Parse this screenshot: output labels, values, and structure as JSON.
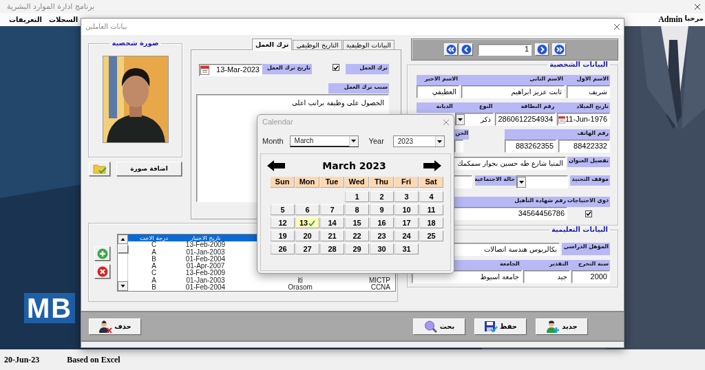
{
  "app": {
    "title": "برنامج ادارة الموارد البشرية",
    "menu": [
      {
        "label": "السجلات"
      },
      {
        "label": "التعريفات"
      }
    ],
    "user": "Admin",
    "greeting": "مرحبا",
    "logo": "MB"
  },
  "dialog": {
    "title": "بيانات العاملين",
    "photo": {
      "legend": "صورة شخصية",
      "kind": "picture",
      "add_button": "اضافة صورة"
    },
    "tabs": [
      {
        "label": "البيانات الوظيفية",
        "selected": false
      },
      {
        "label": "التاريخ الوظيفي",
        "selected": false
      },
      {
        "label": "ترك العمل",
        "selected": true
      }
    ],
    "leave_work": {
      "left_label": "ترك العمل",
      "left_checked": true,
      "date_label": "تاريخ ترك العمل",
      "date": "13-Mar-2023",
      "reason_label": "سبب ترك العمل",
      "reason": "الحصول على وظيفة براتب اعلى"
    },
    "certificates": {
      "rows": [
        {
          "selected": true,
          "date": "تاريخ الاختبار",
          "grade": "درجة الاخت"
        },
        {
          "selected": false,
          "date": "13-Feb-2009",
          "grade": "C"
        },
        {
          "selected": false,
          "date": "01-Jan-2003",
          "grade": "A"
        },
        {
          "selected": false,
          "date": "01-Feb-2004",
          "grade": "B"
        },
        {
          "selected": false,
          "date": "01-Apr-2007",
          "grade": "A"
        },
        {
          "selected": false,
          "date": "13-Feb-2009",
          "grade": "C"
        },
        {
          "selected": false,
          "column_4": "MICTP",
          "column_3": "iti",
          "date": "01-Jan-2003",
          "grade": "A"
        },
        {
          "selected": false,
          "column_4": "CCNA",
          "column_3": "Orasom",
          "date": "01-Feb-2004",
          "grade": "B"
        }
      ]
    },
    "navigator": {
      "record": "1"
    },
    "personal": {
      "legend": "البيانات الشخصية",
      "first_name_label": "الاسم الاول",
      "first_name": "شريف",
      "middle_name_label": "الاسم الثاني",
      "middle_name": "ثابت عزيز ابراهيم",
      "last_name_label": "الاسم الاخير",
      "last_name": "العطيفي",
      "birth_date_label": "تاريخ الميلاد",
      "birth_date": "11-Jun-1976",
      "id_number_label": "رقم البطاقة",
      "id_number": "2860612254934",
      "gender_label": "النوع",
      "gender": "ذكر",
      "religion_label": "الديانة",
      "nationality_label": "الجن",
      "phone_label": "رقم الهاتف",
      "phone_1": "883262355",
      "phone_2": "88422332",
      "address_label": "تفصيل العنوان",
      "address": "المنيا شارع طه حسين بجوار سمكمك",
      "military_label": "موقف التجنيد",
      "marital_label": "حالة الاجتماعية",
      "special_needs_label": "ذوي الاحتياجات",
      "special_needs": true,
      "certificate_label": "رقم شهادة التأهيل",
      "certificate_number": "34564456786"
    },
    "education": {
      "legend": "البيانات التعليمية",
      "qualification_label": "المؤهل الدراسي",
      "qualification": "بكالريوس هندسة اتصالات",
      "year_label": "سنة التخرج",
      "year": "2000",
      "grade_label": "التقدير",
      "grade": "جيد",
      "university_label": "الجامعة",
      "university": "جامعة اسيوط"
    },
    "buttons": [
      {
        "kind": "new",
        "label": "جديد"
      },
      {
        "kind": "save",
        "label": "حفظ"
      },
      {
        "kind": "search",
        "label": "بحث"
      },
      {
        "kind": "delete",
        "label": "حذف"
      }
    ]
  },
  "calendar": {
    "title": "Calendar",
    "month_label": "Month",
    "month": "March",
    "year_label": "Year",
    "year": "2023",
    "heading": "March 2023",
    "weekdays": {
      "sun": "Sun",
      "mon": "Mon",
      "tue": "Tue",
      "wed": "Wed",
      "thu": "Thu",
      "fri": "Fri",
      "sat": "Sat"
    },
    "weeks": [
      {
        "wed": {
          "day": "1",
          "selected": false
        },
        "thu": {
          "day": "2",
          "selected": false
        },
        "fri": {
          "day": "3",
          "selected": false
        },
        "sat": {
          "day": "4",
          "selected": false
        }
      },
      {
        "sun": {
          "day": "5",
          "selected": false
        },
        "mon": {
          "day": "6",
          "selected": false
        },
        "tue": {
          "day": "7",
          "selected": false
        },
        "wed": {
          "day": "8",
          "selected": false
        },
        "thu": {
          "day": "9",
          "selected": false
        },
        "fri": {
          "day": "10",
          "selected": false
        },
        "sat": {
          "day": "11",
          "selected": false
        }
      },
      {
        "sun": {
          "day": "12",
          "selected": false
        },
        "mon": {
          "day": "13",
          "selected": true
        },
        "tue": {
          "day": "14",
          "selected": false
        },
        "wed": {
          "day": "15",
          "selected": false
        },
        "thu": {
          "day": "16",
          "selected": false
        },
        "fri": {
          "day": "17",
          "selected": false
        },
        "sat": {
          "day": "18",
          "selected": false
        }
      },
      {
        "sun": {
          "day": "19",
          "selected": false
        },
        "mon": {
          "day": "20",
          "selected": false
        },
        "tue": {
          "day": "21",
          "selected": false
        },
        "wed": {
          "day": "22",
          "selected": false
        },
        "thu": {
          "day": "23",
          "selected": false
        },
        "fri": {
          "day": "24",
          "selected": false
        },
        "sat": {
          "day": "25",
          "selected": false
        }
      },
      {
        "sun": {
          "day": "26",
          "selected": false
        },
        "mon": {
          "day": "27",
          "selected": false
        },
        "tue": {
          "day": "28",
          "selected": false
        },
        "wed": {
          "day": "29",
          "selected": false
        },
        "thu": {
          "day": "30",
          "selected": false
        },
        "fri": {
          "day": "31",
          "selected": false
        }
      }
    ]
  },
  "status_bar": {
    "date": "20-Jun-23",
    "note": "Based on Excel"
  }
}
